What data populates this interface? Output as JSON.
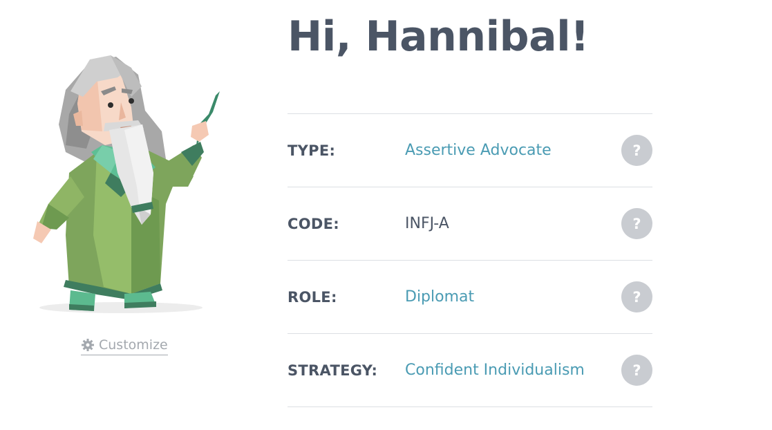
{
  "profile": {
    "greeting": "Hi, Hannibal!",
    "customize_label": "Customize",
    "avatar_icon": "wizard-avatar",
    "rows": [
      {
        "label": "TYPE:",
        "value": "Assertive Advocate",
        "value_is_link": true,
        "help_symbol": "?"
      },
      {
        "label": "CODE:",
        "value": "INFJ-A",
        "value_is_link": false,
        "help_symbol": "?"
      },
      {
        "label": "ROLE:",
        "value": "Diplomat",
        "value_is_link": true,
        "help_symbol": "?"
      },
      {
        "label": "STRATEGY:",
        "value": "Confident Individualism",
        "value_is_link": true,
        "help_symbol": "?"
      }
    ]
  },
  "colors": {
    "heading": "#4b5565",
    "link": "#4a9bb3",
    "help_button": "#c9ccd1",
    "divider": "#dcdfe3",
    "muted": "#a3a8ae",
    "robe_green": "#7ea55c",
    "robe_dark": "#3f7d5f"
  }
}
